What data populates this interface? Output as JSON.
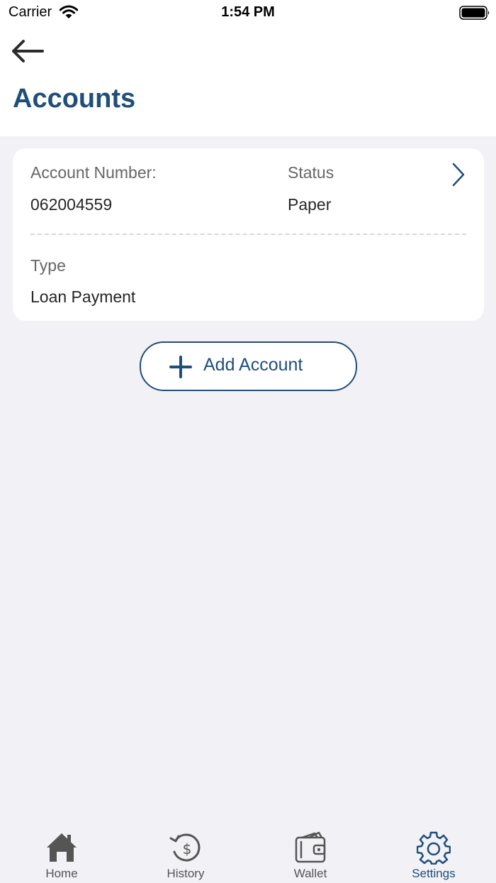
{
  "status_bar": {
    "carrier": "Carrier",
    "time": "1:54 PM"
  },
  "header": {
    "title": "Accounts",
    "back_icon": "arrow-left-icon"
  },
  "account_card": {
    "account_number_label": "Account Number:",
    "account_number": "062004559",
    "status_label": "Status",
    "status_value": "Paper",
    "type_label": "Type",
    "type_value": "Loan Payment"
  },
  "add_account": {
    "label": "Add Account"
  },
  "tab_bar": {
    "tabs": [
      {
        "label": "Home",
        "icon": "home-icon"
      },
      {
        "label": "History",
        "icon": "history-dollar-icon"
      },
      {
        "label": "Wallet",
        "icon": "wallet-icon"
      },
      {
        "label": "Settings",
        "icon": "gear-icon"
      }
    ],
    "active": "Settings"
  },
  "colors": {
    "accent": "#1f4e79",
    "background": "#f1f1f6",
    "card": "#ffffff",
    "muted_text": "#666666",
    "tab_inactive": "#555555"
  }
}
